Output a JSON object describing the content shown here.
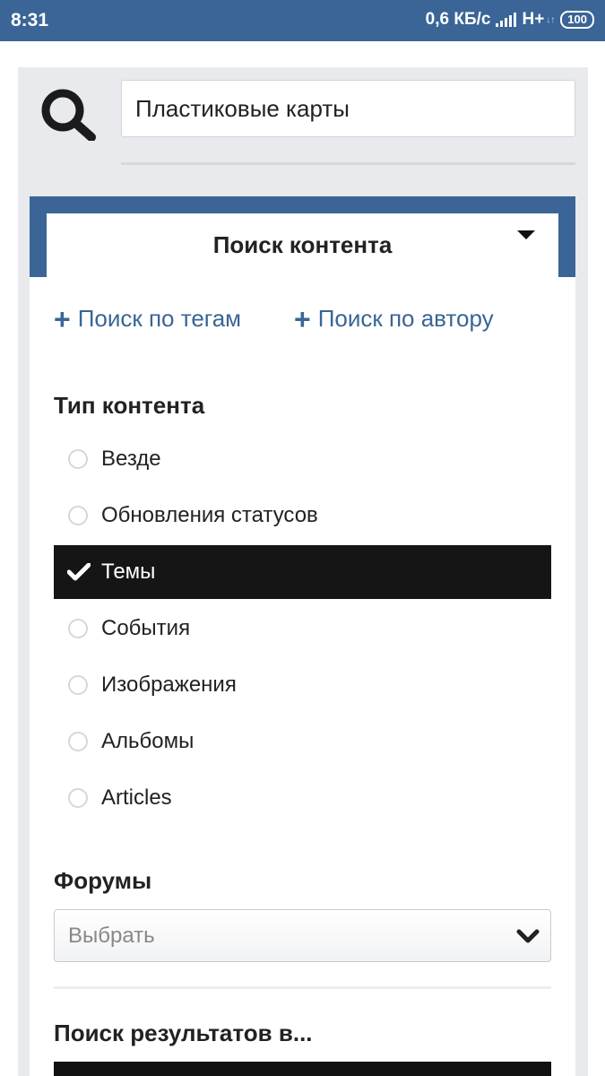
{
  "statusbar": {
    "time": "8:31",
    "speed": "0,6 КБ/с",
    "network": "H+",
    "network_sub": "↓↑",
    "battery": "100"
  },
  "search": {
    "value": "Пластиковые карты",
    "icon": "search-icon"
  },
  "panel": {
    "title": "Поиск контента",
    "links": [
      {
        "label": "Поиск по тегам"
      },
      {
        "label": "Поиск по автору"
      }
    ],
    "content_type": {
      "title": "Тип контента",
      "options": [
        {
          "label": "Везде",
          "selected": false
        },
        {
          "label": "Обновления статусов",
          "selected": false
        },
        {
          "label": "Темы",
          "selected": true
        },
        {
          "label": "События",
          "selected": false
        },
        {
          "label": "Изображения",
          "selected": false
        },
        {
          "label": "Альбомы",
          "selected": false
        },
        {
          "label": "Articles",
          "selected": false
        }
      ]
    },
    "forums": {
      "title": "Форумы",
      "placeholder": "Выбрать"
    },
    "search_results": {
      "title": "Поиск результатов в..."
    }
  },
  "colors": {
    "accent": "#3a6596",
    "selected_bg": "#151515"
  }
}
